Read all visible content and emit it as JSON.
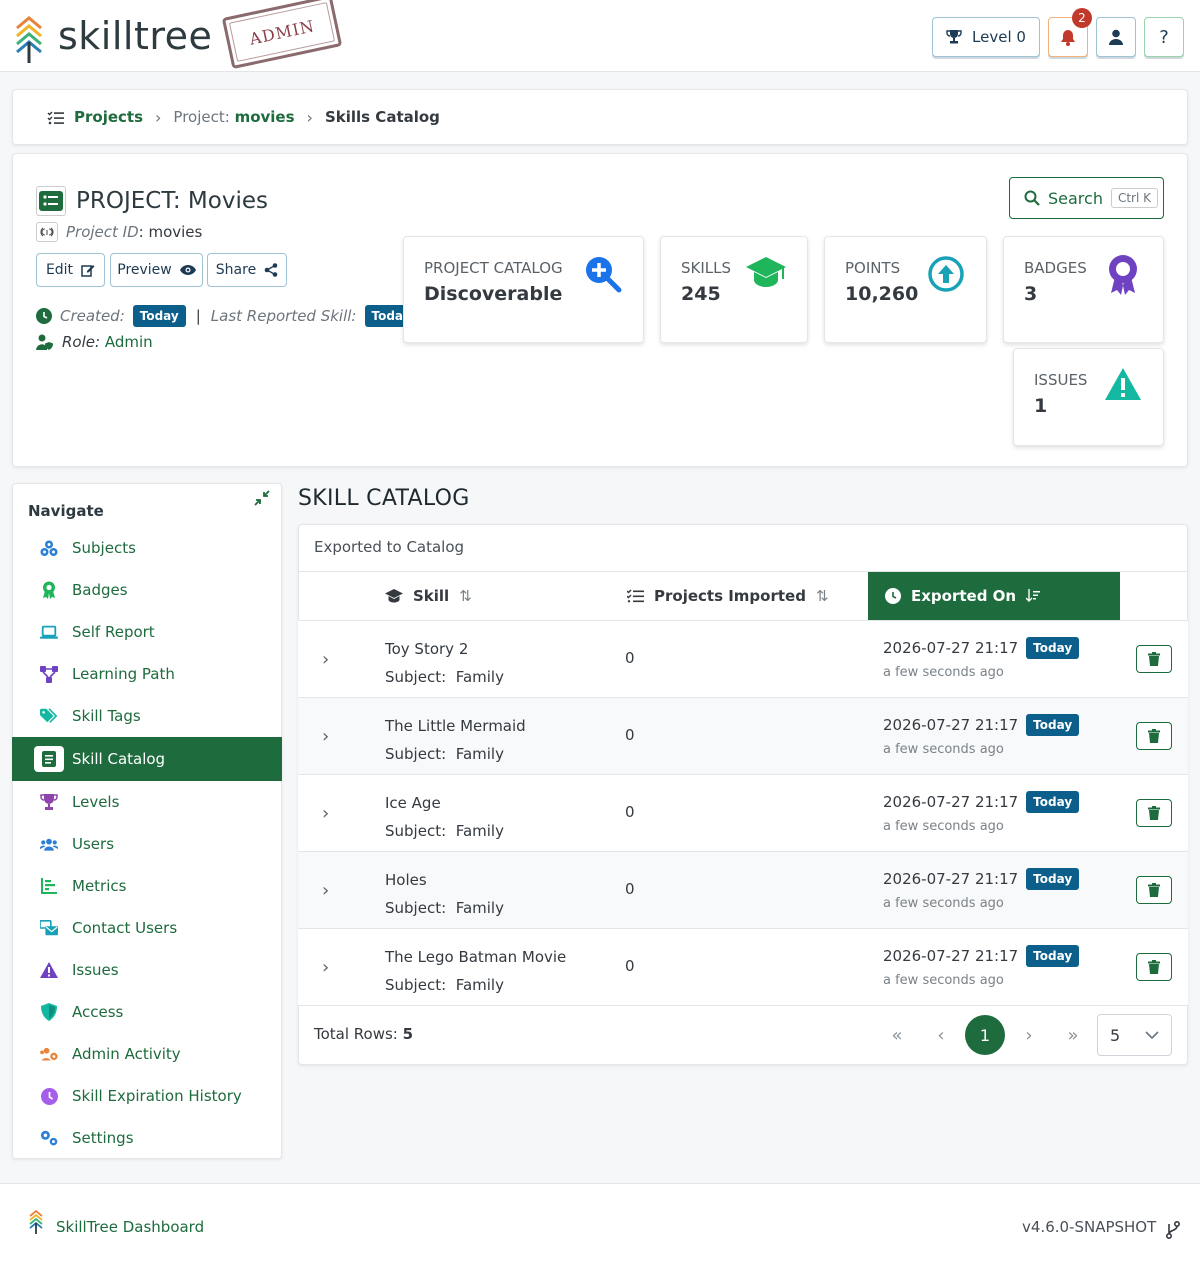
{
  "header": {
    "brand": "skilltree",
    "stamp": "ADMIN",
    "level_label": "Level 0",
    "notifications_count": "2",
    "help_label": "?"
  },
  "breadcrumb": {
    "projects": "Projects",
    "project_prefix": "Project:",
    "project_name": "movies",
    "current": "Skills Catalog"
  },
  "project": {
    "title": "PROJECT: Movies",
    "id_label": "Project ID",
    "id_value": ": movies",
    "edit": "Edit",
    "preview": "Preview",
    "share": "Share",
    "created_label": "Created:",
    "created_value": "Today",
    "separator": "|",
    "last_reported_label": "Last Reported Skill:",
    "last_reported_value": "Today",
    "role_label": "Role:",
    "role_value": "Admin",
    "search_label": "Search",
    "search_kbd": "Ctrl K"
  },
  "stats": {
    "catalog": {
      "label": "PROJECT CATALOG",
      "value": "Discoverable",
      "icon": "magnifier-plus-icon",
      "color": "#1a73e8"
    },
    "skills": {
      "label": "SKILLS",
      "value": "245",
      "icon": "graduation-cap-icon",
      "color": "#1fb55a"
    },
    "points": {
      "label": "POINTS",
      "value": "10,260",
      "icon": "arrow-up-circle-icon",
      "color": "#17a2b8"
    },
    "badges": {
      "label": "BADGES",
      "value": "3",
      "icon": "award-icon",
      "color": "#6f42c1"
    },
    "issues": {
      "label": "ISSUES",
      "value": "1",
      "icon": "warning-triangle-icon",
      "color": "#14b8a0"
    }
  },
  "sidebar": {
    "title": "Navigate",
    "items": [
      {
        "label": "Subjects",
        "icon": "cubes-icon"
      },
      {
        "label": "Badges",
        "icon": "award-icon"
      },
      {
        "label": "Self Report",
        "icon": "laptop-icon"
      },
      {
        "label": "Learning Path",
        "icon": "network-icon"
      },
      {
        "label": "Skill Tags",
        "icon": "tags-icon"
      },
      {
        "label": "Skill Catalog",
        "icon": "book-icon"
      },
      {
        "label": "Levels",
        "icon": "trophy-icon"
      },
      {
        "label": "Users",
        "icon": "users-icon"
      },
      {
        "label": "Metrics",
        "icon": "chart-icon"
      },
      {
        "label": "Contact Users",
        "icon": "mail-bulk-icon"
      },
      {
        "label": "Issues",
        "icon": "warning-triangle-icon"
      },
      {
        "label": "Access",
        "icon": "shield-icon"
      },
      {
        "label": "Admin Activity",
        "icon": "users-cog-icon"
      },
      {
        "label": "Skill Expiration History",
        "icon": "clock-icon"
      },
      {
        "label": "Settings",
        "icon": "cogs-icon"
      }
    ]
  },
  "main": {
    "title": "SKILL CATALOG",
    "subtitle": "Exported to Catalog",
    "columns": {
      "skill": "Skill",
      "projects_imported": "Projects Imported",
      "exported_on": "Exported On"
    },
    "rows": [
      {
        "skill": "Toy Story 2",
        "subject_label": "Subject:",
        "subject": "Family",
        "imported": "0",
        "date": "2026-07-27 21:17",
        "badge": "Today",
        "ago": "a few seconds ago"
      },
      {
        "skill": "The Little Mermaid",
        "subject_label": "Subject:",
        "subject": "Family",
        "imported": "0",
        "date": "2026-07-27 21:17",
        "badge": "Today",
        "ago": "a few seconds ago"
      },
      {
        "skill": "Ice Age",
        "subject_label": "Subject:",
        "subject": "Family",
        "imported": "0",
        "date": "2026-07-27 21:17",
        "badge": "Today",
        "ago": "a few seconds ago"
      },
      {
        "skill": "Holes",
        "subject_label": "Subject:",
        "subject": "Family",
        "imported": "0",
        "date": "2026-07-27 21:17",
        "badge": "Today",
        "ago": "a few seconds ago"
      },
      {
        "skill": "The Lego Batman Movie",
        "subject_label": "Subject:",
        "subject": "Family",
        "imported": "0",
        "date": "2026-07-27 21:17",
        "badge": "Today",
        "ago": "a few seconds ago"
      }
    ],
    "total_label": "Total Rows:",
    "total_value": "5",
    "current_page": "1",
    "per_page": "5"
  },
  "footer": {
    "link": "SkillTree Dashboard",
    "version": "v4.6.0-SNAPSHOT"
  },
  "colors": {
    "primary": "#1e6b3d",
    "info_badge": "#0b5f8a"
  }
}
